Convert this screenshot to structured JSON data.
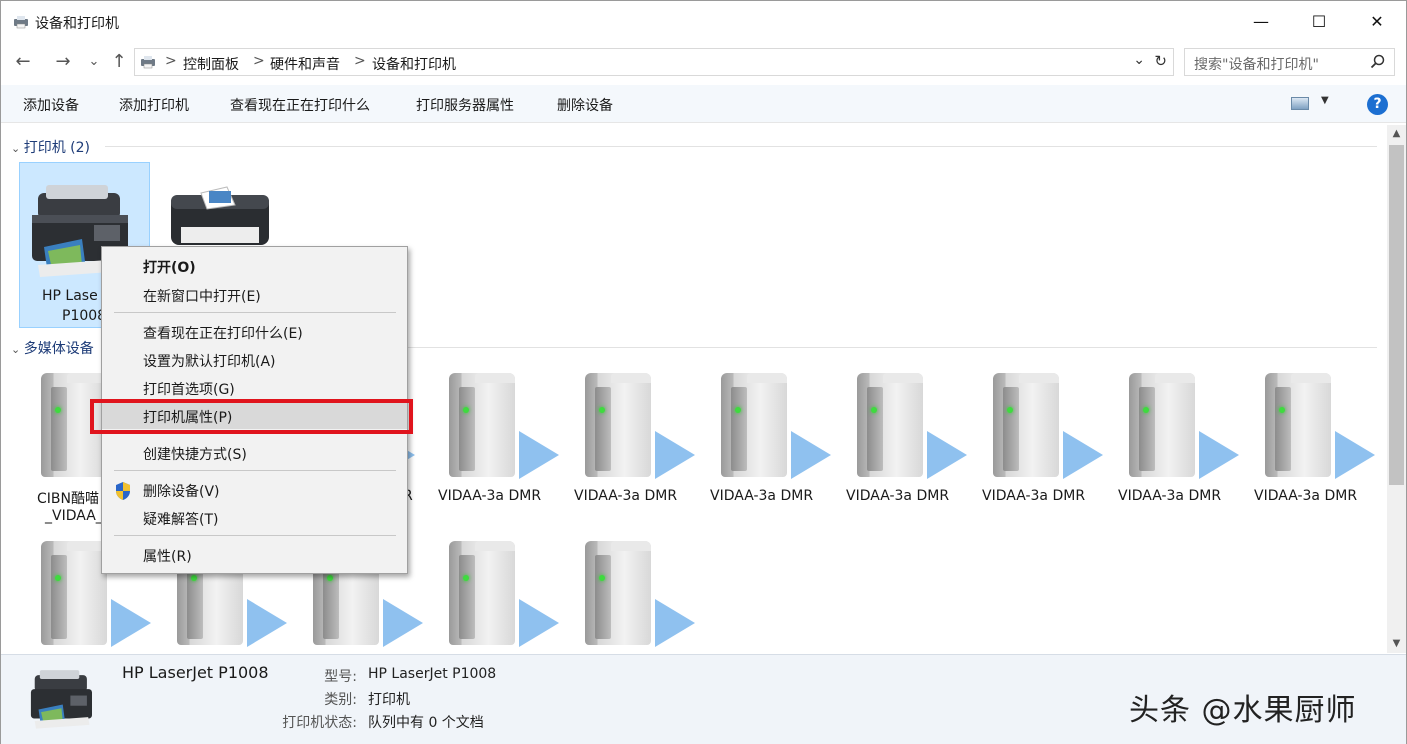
{
  "window": {
    "title": "设备和打印机"
  },
  "window_controls": {
    "minimize": "—",
    "maximize": "☐",
    "close": "✕"
  },
  "nav": {
    "back": "←",
    "forward": "→",
    "recent": "⌄",
    "up": "↑"
  },
  "address": {
    "crumbs": [
      "控制面板",
      "硬件和声音",
      "设备和打印机"
    ],
    "separator": ">"
  },
  "search": {
    "placeholder": "搜索\"设备和打印机\""
  },
  "toolbar": {
    "items": [
      "添加设备",
      "添加打印机",
      "查看现在正在打印什么",
      "打印服务器属性",
      "删除设备"
    ],
    "help": "?"
  },
  "groups": {
    "printers": {
      "label": "打印机 (2)"
    },
    "media": {
      "label": "多媒体设备"
    }
  },
  "printers": [
    {
      "name_line1": "HP Lase",
      "name_line2": "P1008",
      "selected": true
    }
  ],
  "media_devices": [
    {
      "label": "CIBN酷喵",
      "label2": "_VIDAA_"
    },
    {
      "label": "VIDAA-3a DMR"
    },
    {
      "label": "VIDAA-3a DMR"
    },
    {
      "label": "VIDAA-3a DMR"
    },
    {
      "label": "VIDAA-3a DMR"
    },
    {
      "label": "VIDAA-3a DMR"
    },
    {
      "label": "VIDAA-3a DMR"
    },
    {
      "label": "VIDAA-3a DMR"
    }
  ],
  "media_partial_label": "R",
  "context_menu": {
    "items": [
      {
        "label": "打开(O)",
        "bold": true
      },
      {
        "label": "在新窗口中打开(E)"
      },
      {
        "label": "查看现在正在打印什么(E)"
      },
      {
        "label": "设置为默认打印机(A)"
      },
      {
        "label": "打印首选项(G)"
      },
      {
        "label": "打印机属性(P)",
        "highlighted": true
      },
      {
        "label": "创建快捷方式(S)"
      },
      {
        "label": "删除设备(V)",
        "icon": "shield-icon"
      },
      {
        "label": "疑难解答(T)"
      },
      {
        "label": "属性(R)"
      }
    ]
  },
  "details": {
    "name": "HP LaserJet P1008",
    "rows": [
      {
        "key": "型号:",
        "value": "HP LaserJet P1008"
      },
      {
        "key": "类别:",
        "value": "打印机"
      },
      {
        "key": "打印机状态:",
        "value": "队列中有 0 个文档"
      }
    ]
  },
  "watermark": "头条 @水果厨师",
  "colors": {
    "selection": "#cce8ff",
    "highlight_box": "#e0141d",
    "group_header": "#1e3c78",
    "accent": "#1c6fd1"
  }
}
